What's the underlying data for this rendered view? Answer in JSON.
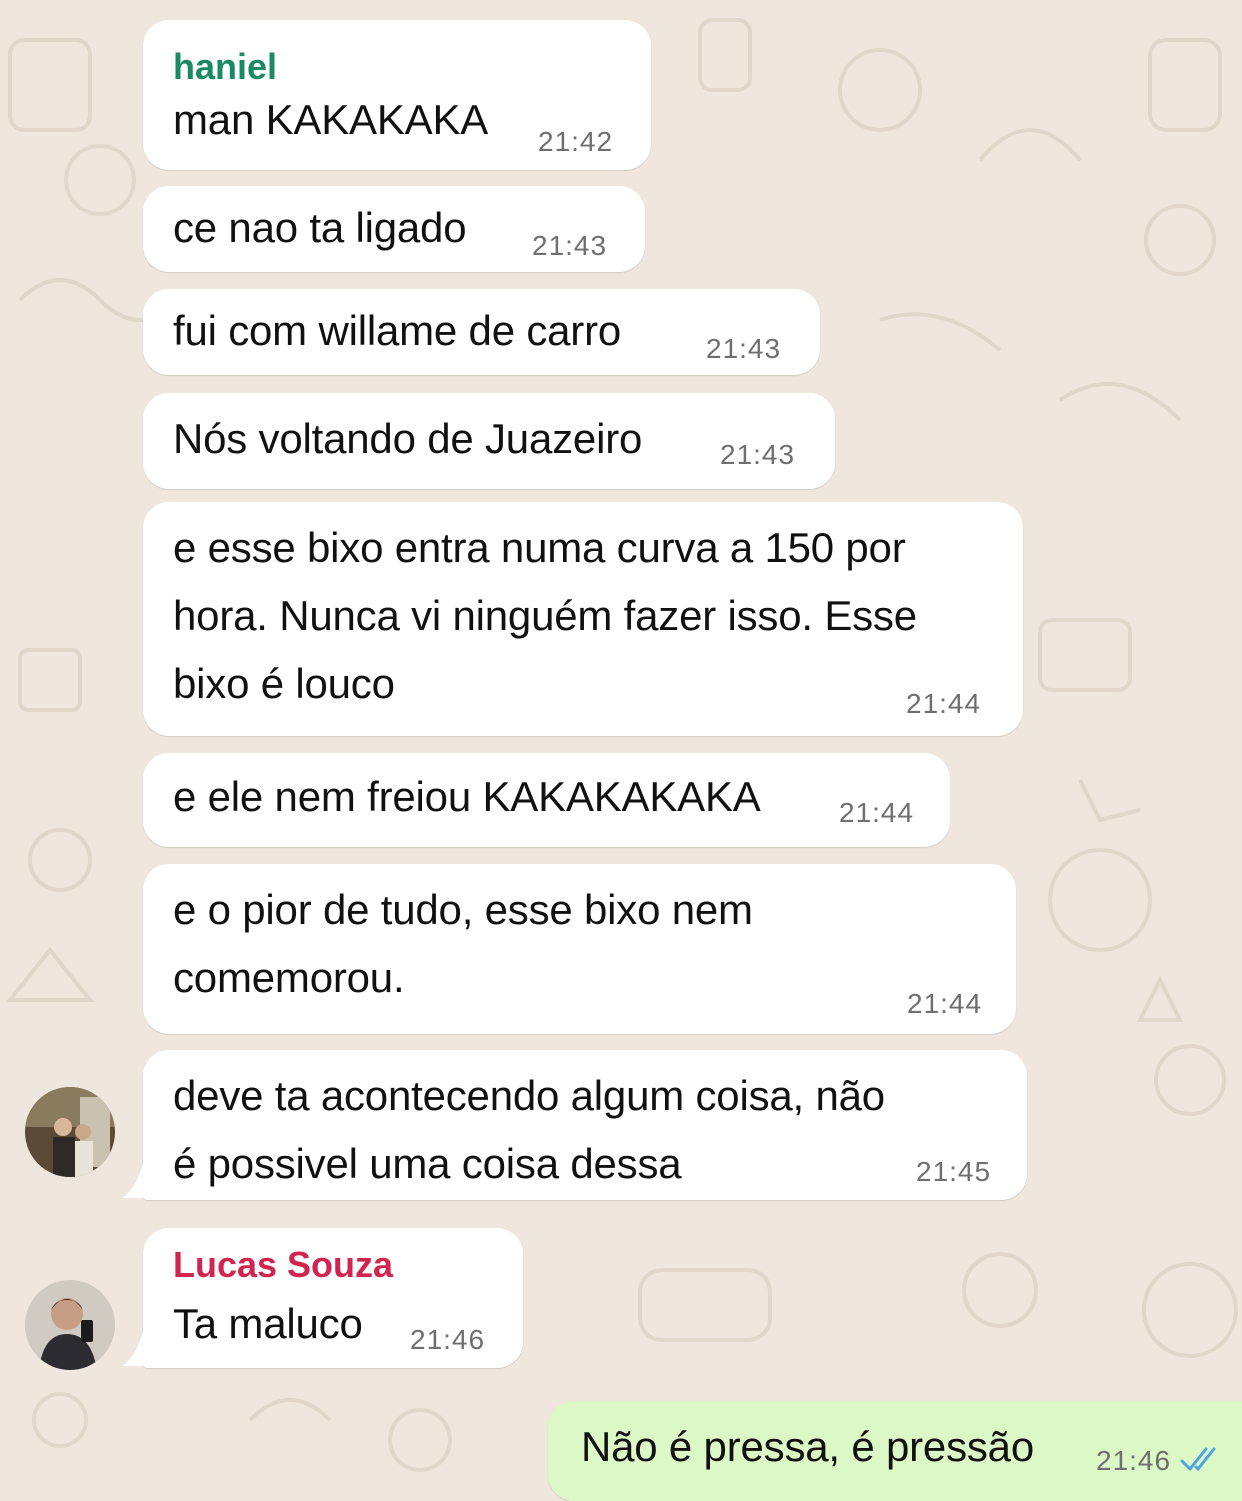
{
  "colors": {
    "background": "#efe7dd",
    "incoming_bubble": "#ffffff",
    "outgoing_bubble": "#dcf8c6",
    "sender_haniel": "#1a8a63",
    "sender_lucas": "#d1244f",
    "read_ticks": "#4fa3e0"
  },
  "messages": [
    {
      "sender": "haniel",
      "text": "man KAKAKAKA",
      "time": "21:42"
    },
    {
      "text": "ce nao ta ligado",
      "time": "21:43"
    },
    {
      "text": "fui com willame de carro",
      "time": "21:43"
    },
    {
      "text": "Nós voltando de Juazeiro",
      "time": "21:43"
    },
    {
      "text": "e esse bixo entra numa curva a 150 por\nhora. Nunca vi ninguém fazer isso. Esse\nbixo é louco",
      "time": "21:44"
    },
    {
      "text": "e ele nem freiou KAKAKAKAKA",
      "time": "21:44"
    },
    {
      "text": "e o pior de tudo, esse bixo nem\ncomemorou.",
      "time": "21:44"
    },
    {
      "text": "deve ta acontecendo algum coisa, não\né possivel uma coisa dessa",
      "time": "21:45"
    },
    {
      "sender": "Lucas Souza",
      "text": "Ta maluco",
      "time": "21:46"
    },
    {
      "text": "Não é pressa, é pressão",
      "time": "21:46",
      "status": "read-double-check-icon"
    }
  ],
  "avatars": [
    "haniel-avatar",
    "lucas-souza-avatar"
  ]
}
